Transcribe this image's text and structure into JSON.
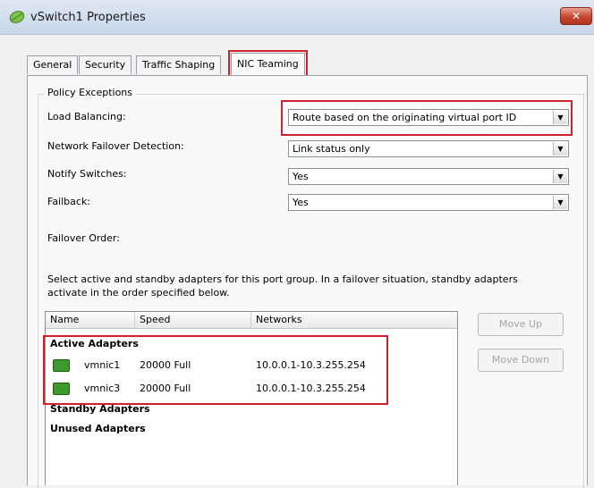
{
  "window": {
    "title": "vSwitch1 Properties",
    "close_label": "✕"
  },
  "tabs": [
    {
      "label": "General",
      "active": false
    },
    {
      "label": "Security",
      "active": false
    },
    {
      "label": "Traffic Shaping",
      "active": false
    },
    {
      "label": "NIC Teaming",
      "active": true
    }
  ],
  "policy": {
    "group_label": "Policy Exceptions",
    "load_balancing": {
      "label": "Load Balancing:",
      "value": "Route based on the originating virtual port ID"
    },
    "failover_detection": {
      "label": "Network Failover Detection:",
      "value": "Link status only"
    },
    "notify_switches": {
      "label": "Notify Switches:",
      "value": "Yes"
    },
    "failback": {
      "label": "Failback:",
      "value": "Yes"
    },
    "failover_order_label": "Failover Order:",
    "description": "Select active and standby adapters for this port group.  In a failover situation, standby adapters activate  in the order specified below."
  },
  "adapters": {
    "columns": [
      "Name",
      "Speed",
      "Networks"
    ],
    "active_label": "Active Adapters",
    "standby_label": "Standby Adapters",
    "unused_label": "Unused Adapters",
    "active": [
      {
        "name": "vmnic1",
        "speed": "20000 Full",
        "networks": "10.0.0.1-10.3.255.254"
      },
      {
        "name": "vmnic3",
        "speed": "20000 Full",
        "networks": "10.0.0.1-10.3.255.254"
      }
    ]
  },
  "buttons": {
    "move_up": "Move Up",
    "move_down": "Move Down"
  },
  "colors": {
    "highlight": "#d1202e",
    "nic_icon": "#3d9a2b"
  },
  "icons": {
    "app": "vswitch-leaf-icon",
    "adapter": "network-adapter-icon",
    "combo_arrow": "chevron-down-icon"
  }
}
